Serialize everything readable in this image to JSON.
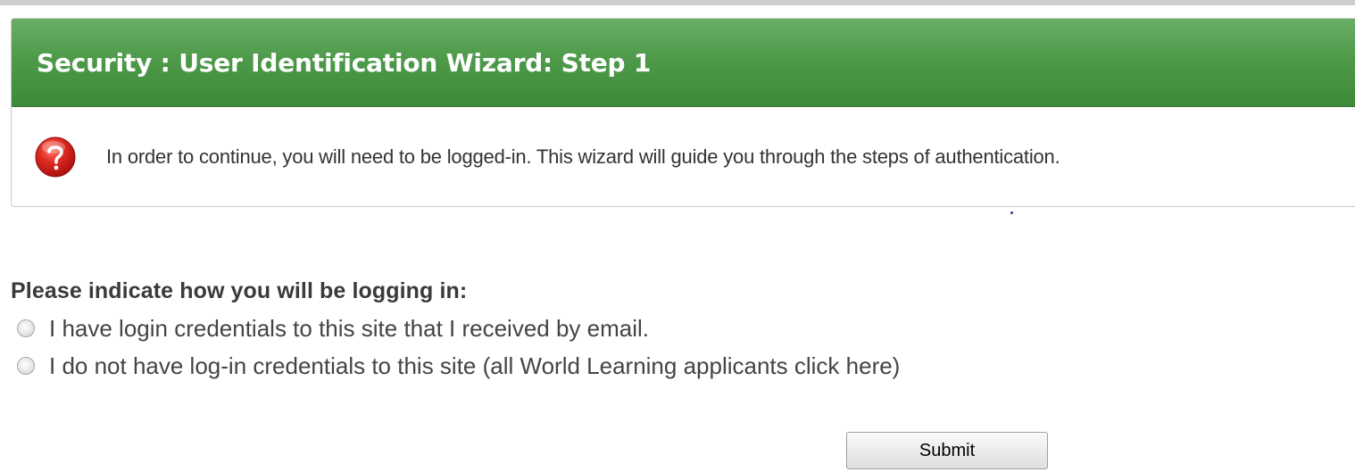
{
  "wizard": {
    "title": "Security : User Identification Wizard: Step 1",
    "info_text": "In order to continue, you will need to be logged-in. This wizard will guide you through the steps of authentication.",
    "icon": "question-mark-icon",
    "header_color": "#4e9a4a",
    "icon_color": "#d42a2a"
  },
  "login": {
    "question": "Please indicate how you will be logging in:",
    "options": [
      {
        "label": "I have login credentials to this site that I received by email.",
        "selected": false
      },
      {
        "label": "I do not have log-in credentials to this site (all World Learning applicants click here)",
        "selected": false
      }
    ]
  },
  "submit": {
    "label": "Submit"
  }
}
